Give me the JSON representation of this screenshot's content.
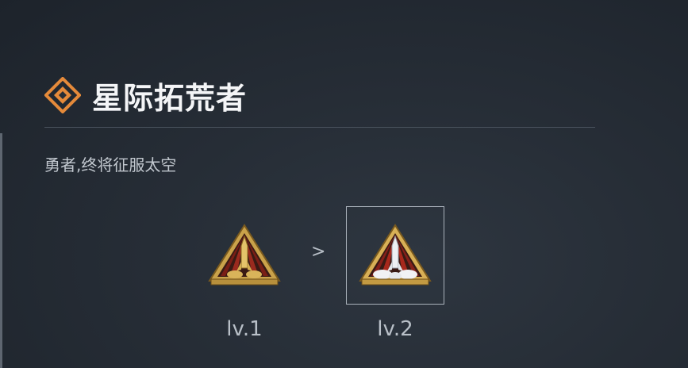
{
  "header": {
    "icon": "diamond-emblem-icon",
    "title": "星际拓荒者",
    "accent_color": "#e58a3a"
  },
  "description": "勇者,终将征服太空",
  "levels": [
    {
      "label": "lv.1",
      "icon": "rocket-badge-gold-icon",
      "selected": false
    },
    {
      "label": "lv.2",
      "icon": "rocket-badge-silver-icon",
      "selected": true
    }
  ],
  "separator": ">"
}
